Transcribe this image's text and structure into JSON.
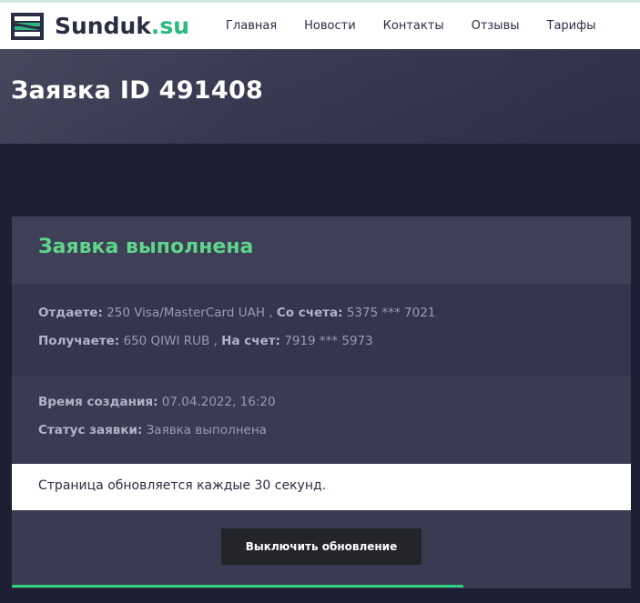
{
  "brand": {
    "name": "Sunduk",
    "tld": ".su"
  },
  "nav": [
    {
      "label": "Главная"
    },
    {
      "label": "Новости"
    },
    {
      "label": "Контакты"
    },
    {
      "label": "Отзывы"
    },
    {
      "label": "Тарифы"
    }
  ],
  "page": {
    "title": "Заявка ID 491408"
  },
  "order": {
    "status_title": "Заявка выполнена",
    "give_label": "Отдаете:",
    "give_value": " 250 Visa/MasterCard UAH , ",
    "from_label": "Со счета:",
    "from_value": " 5375 *** 7021",
    "receive_label": "Получаете:",
    "receive_value": " 650 QIWI RUB , ",
    "to_label": "На счет:",
    "to_value": " 7919 *** 5973",
    "created_label": "Время создания:",
    "created_value": " 07.04.2022, 16:20",
    "status_label": "Статус заявки:",
    "status_value": " Заявка выполнена"
  },
  "notice": {
    "text": "Страница обновляется каждые 30 секунд."
  },
  "button": {
    "label": "Выключить обновление"
  },
  "progress": {
    "fraction": 0.73
  },
  "colors": {
    "accent": "#2ab97e",
    "success": "#5ed58a",
    "progress": "#2fd07f"
  }
}
